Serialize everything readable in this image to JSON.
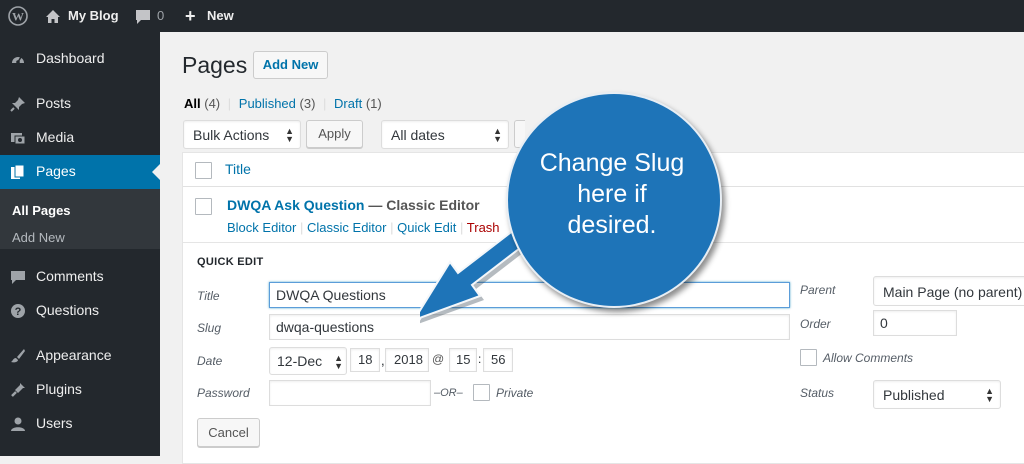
{
  "admin_bar": {
    "site_name": "My Blog",
    "comments_count": "0",
    "new_label": "New"
  },
  "sidebar": {
    "items": [
      {
        "label": "Dashboard"
      },
      {
        "label": "Posts"
      },
      {
        "label": "Media"
      },
      {
        "label": "Pages"
      },
      {
        "label": "Comments"
      },
      {
        "label": "Questions"
      },
      {
        "label": "Appearance"
      },
      {
        "label": "Plugins"
      },
      {
        "label": "Users"
      }
    ],
    "submenu": [
      {
        "label": "All Pages"
      },
      {
        "label": "Add New"
      }
    ]
  },
  "main": {
    "title": "Pages",
    "add_new": "Add New",
    "filters": {
      "all": "All",
      "all_count": "(4)",
      "published": "Published",
      "published_count": "(3)",
      "draft": "Draft",
      "draft_count": "(1)",
      "sep": "|"
    },
    "bulk_actions": "Bulk Actions",
    "apply": "Apply",
    "all_dates": "All dates",
    "table": {
      "col_title": "Title",
      "row": {
        "title": "DWQA Ask Question",
        "suffix": "— Classic Editor",
        "actions": [
          "Block Editor",
          "Classic Editor",
          "Quick Edit",
          "Trash"
        ]
      }
    },
    "quick_edit": {
      "heading": "QUICK EDIT",
      "title_label": "Title",
      "title_value": "DWQA Questions",
      "slug_label": "Slug",
      "slug_value": "dwqa-questions",
      "date_label": "Date",
      "month": "12-Dec",
      "day": "18",
      "comma": ",",
      "year": "2018",
      "at": "@",
      "hour": "15",
      "colon": ":",
      "minute": "56",
      "password_label": "Password",
      "or": "–OR–",
      "private_label": "Private",
      "parent_label": "Parent",
      "parent_value": "Main Page (no parent)",
      "order_label": "Order",
      "order_value": "0",
      "allow_comments_label": "Allow Comments",
      "status_label": "Status",
      "status_value": "Published",
      "cancel": "Cancel"
    }
  },
  "callout": {
    "lines": [
      "Change Slug",
      "here if",
      "desired."
    ],
    "color": "#1e74b8"
  },
  "colors": {
    "admin_dark": "#23282d",
    "accent": "#0073aa",
    "link": "#0073aa"
  }
}
